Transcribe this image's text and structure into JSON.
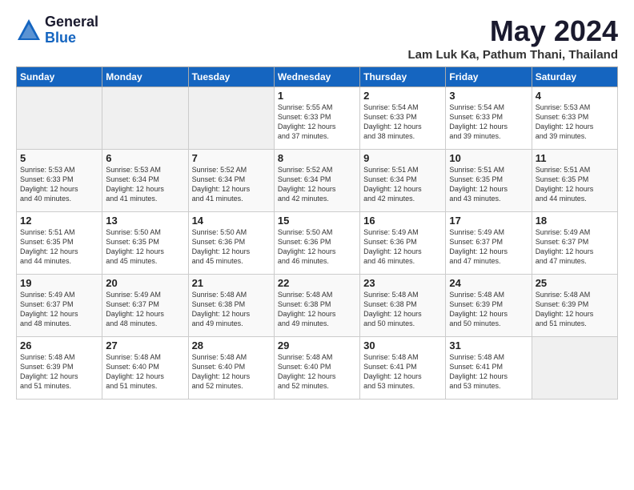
{
  "header": {
    "logo_general": "General",
    "logo_blue": "Blue",
    "title": "May 2024",
    "location": "Lam Luk Ka, Pathum Thani, Thailand"
  },
  "days_of_week": [
    "Sunday",
    "Monday",
    "Tuesday",
    "Wednesday",
    "Thursday",
    "Friday",
    "Saturday"
  ],
  "weeks": [
    [
      {
        "day": "",
        "content": ""
      },
      {
        "day": "",
        "content": ""
      },
      {
        "day": "",
        "content": ""
      },
      {
        "day": "1",
        "content": "Sunrise: 5:55 AM\nSunset: 6:33 PM\nDaylight: 12 hours\nand 37 minutes."
      },
      {
        "day": "2",
        "content": "Sunrise: 5:54 AM\nSunset: 6:33 PM\nDaylight: 12 hours\nand 38 minutes."
      },
      {
        "day": "3",
        "content": "Sunrise: 5:54 AM\nSunset: 6:33 PM\nDaylight: 12 hours\nand 39 minutes."
      },
      {
        "day": "4",
        "content": "Sunrise: 5:53 AM\nSunset: 6:33 PM\nDaylight: 12 hours\nand 39 minutes."
      }
    ],
    [
      {
        "day": "5",
        "content": "Sunrise: 5:53 AM\nSunset: 6:33 PM\nDaylight: 12 hours\nand 40 minutes."
      },
      {
        "day": "6",
        "content": "Sunrise: 5:53 AM\nSunset: 6:34 PM\nDaylight: 12 hours\nand 41 minutes."
      },
      {
        "day": "7",
        "content": "Sunrise: 5:52 AM\nSunset: 6:34 PM\nDaylight: 12 hours\nand 41 minutes."
      },
      {
        "day": "8",
        "content": "Sunrise: 5:52 AM\nSunset: 6:34 PM\nDaylight: 12 hours\nand 42 minutes."
      },
      {
        "day": "9",
        "content": "Sunrise: 5:51 AM\nSunset: 6:34 PM\nDaylight: 12 hours\nand 42 minutes."
      },
      {
        "day": "10",
        "content": "Sunrise: 5:51 AM\nSunset: 6:35 PM\nDaylight: 12 hours\nand 43 minutes."
      },
      {
        "day": "11",
        "content": "Sunrise: 5:51 AM\nSunset: 6:35 PM\nDaylight: 12 hours\nand 44 minutes."
      }
    ],
    [
      {
        "day": "12",
        "content": "Sunrise: 5:51 AM\nSunset: 6:35 PM\nDaylight: 12 hours\nand 44 minutes."
      },
      {
        "day": "13",
        "content": "Sunrise: 5:50 AM\nSunset: 6:35 PM\nDaylight: 12 hours\nand 45 minutes."
      },
      {
        "day": "14",
        "content": "Sunrise: 5:50 AM\nSunset: 6:36 PM\nDaylight: 12 hours\nand 45 minutes."
      },
      {
        "day": "15",
        "content": "Sunrise: 5:50 AM\nSunset: 6:36 PM\nDaylight: 12 hours\nand 46 minutes."
      },
      {
        "day": "16",
        "content": "Sunrise: 5:49 AM\nSunset: 6:36 PM\nDaylight: 12 hours\nand 46 minutes."
      },
      {
        "day": "17",
        "content": "Sunrise: 5:49 AM\nSunset: 6:37 PM\nDaylight: 12 hours\nand 47 minutes."
      },
      {
        "day": "18",
        "content": "Sunrise: 5:49 AM\nSunset: 6:37 PM\nDaylight: 12 hours\nand 47 minutes."
      }
    ],
    [
      {
        "day": "19",
        "content": "Sunrise: 5:49 AM\nSunset: 6:37 PM\nDaylight: 12 hours\nand 48 minutes."
      },
      {
        "day": "20",
        "content": "Sunrise: 5:49 AM\nSunset: 6:37 PM\nDaylight: 12 hours\nand 48 minutes."
      },
      {
        "day": "21",
        "content": "Sunrise: 5:48 AM\nSunset: 6:38 PM\nDaylight: 12 hours\nand 49 minutes."
      },
      {
        "day": "22",
        "content": "Sunrise: 5:48 AM\nSunset: 6:38 PM\nDaylight: 12 hours\nand 49 minutes."
      },
      {
        "day": "23",
        "content": "Sunrise: 5:48 AM\nSunset: 6:38 PM\nDaylight: 12 hours\nand 50 minutes."
      },
      {
        "day": "24",
        "content": "Sunrise: 5:48 AM\nSunset: 6:39 PM\nDaylight: 12 hours\nand 50 minutes."
      },
      {
        "day": "25",
        "content": "Sunrise: 5:48 AM\nSunset: 6:39 PM\nDaylight: 12 hours\nand 51 minutes."
      }
    ],
    [
      {
        "day": "26",
        "content": "Sunrise: 5:48 AM\nSunset: 6:39 PM\nDaylight: 12 hours\nand 51 minutes."
      },
      {
        "day": "27",
        "content": "Sunrise: 5:48 AM\nSunset: 6:40 PM\nDaylight: 12 hours\nand 51 minutes."
      },
      {
        "day": "28",
        "content": "Sunrise: 5:48 AM\nSunset: 6:40 PM\nDaylight: 12 hours\nand 52 minutes."
      },
      {
        "day": "29",
        "content": "Sunrise: 5:48 AM\nSunset: 6:40 PM\nDaylight: 12 hours\nand 52 minutes."
      },
      {
        "day": "30",
        "content": "Sunrise: 5:48 AM\nSunset: 6:41 PM\nDaylight: 12 hours\nand 53 minutes."
      },
      {
        "day": "31",
        "content": "Sunrise: 5:48 AM\nSunset: 6:41 PM\nDaylight: 12 hours\nand 53 minutes."
      },
      {
        "day": "",
        "content": ""
      }
    ]
  ]
}
